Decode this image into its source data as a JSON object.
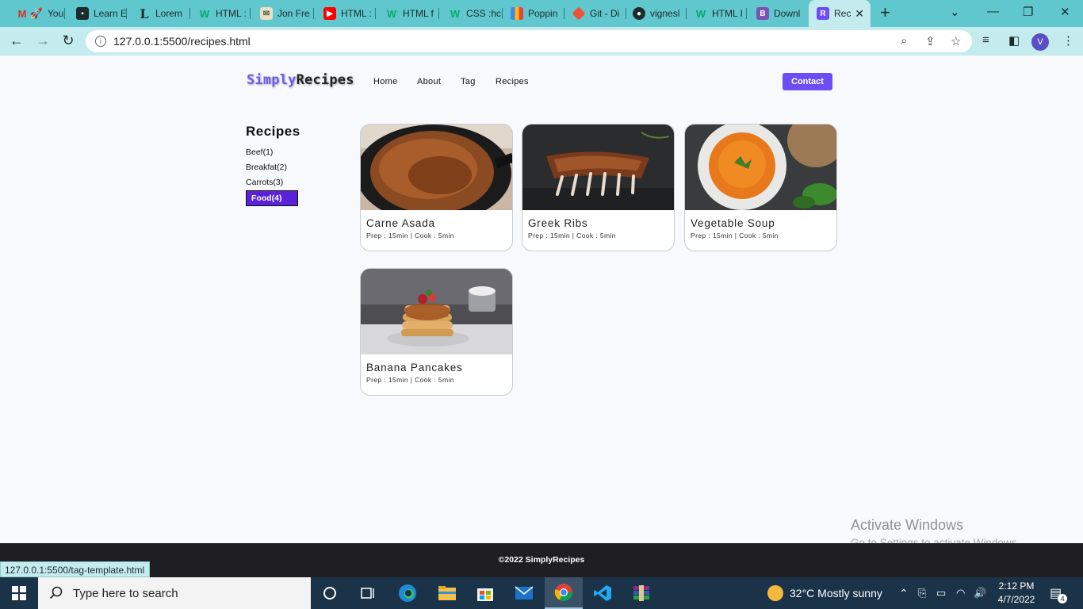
{
  "browser": {
    "tabs": [
      {
        "label": "You",
        "icon": "rocket-icon"
      },
      {
        "label": "Learn E",
        "icon": "contact-card-icon"
      },
      {
        "label": "Lorem",
        "icon": "lorem-l-icon"
      },
      {
        "label": "HTML :",
        "icon": "w3schools-icon"
      },
      {
        "label": "Jon Fre",
        "icon": "mail-icon"
      },
      {
        "label": "HTML :",
        "icon": "youtube-icon"
      },
      {
        "label": "HTML f",
        "icon": "w3schools-icon"
      },
      {
        "label": "CSS :hc",
        "icon": "w3schools-icon"
      },
      {
        "label": "Poppin",
        "icon": "google-fonts-icon"
      },
      {
        "label": "Git - Di",
        "icon": "git-icon"
      },
      {
        "label": "vignesl",
        "icon": "github-icon"
      },
      {
        "label": "HTML I",
        "icon": "w3schools-icon"
      },
      {
        "label": "Downl",
        "icon": "bootstrap-icon"
      },
      {
        "label": "Rec",
        "icon": "recipes-icon",
        "active": true
      }
    ],
    "address": "127.0.0.1:5500/recipes.html",
    "profile_initial": "V",
    "status_url": "127.0.0.1:5500/tag-template.html"
  },
  "site": {
    "logo_part1": "Simply",
    "logo_part2": "Recipes",
    "nav": [
      "Home",
      "About",
      "Tag",
      "Recipes"
    ],
    "contact_label": "Contact",
    "accent": "#6c4df5",
    "sidebar_title": "Recipes",
    "tags": [
      {
        "label": "Beef(1)"
      },
      {
        "label": "Breakfat(2)"
      },
      {
        "label": "Carrots(3)"
      },
      {
        "label": "Food(4)",
        "active": true
      }
    ],
    "recipes": [
      {
        "title": "Carne Asada",
        "meta": "Prep : 15min | Cook : 5min",
        "image": "carne-asada-photo"
      },
      {
        "title": "Greek Ribs",
        "meta": "Prep : 15min | Cook : 5min",
        "image": "greek-ribs-photo"
      },
      {
        "title": "Vegetable Soup",
        "meta": "Prep : 15min | Cook : 5min",
        "image": "vegetable-soup-photo"
      },
      {
        "title": "Banana Pancakes",
        "meta": "Prep : 15min | Cook : 5min",
        "image": "banana-pancakes-photo"
      }
    ],
    "footer": "©2022 SimplyRecipes"
  },
  "os": {
    "watermark_title": "Activate Windows",
    "watermark_sub": "Go to Settings to activate Windows.",
    "search_placeholder": "Type here to search",
    "weather": "32°C  Mostly sunny",
    "time": "2:12 PM",
    "date": "4/7/2022",
    "notification_count": "4"
  }
}
